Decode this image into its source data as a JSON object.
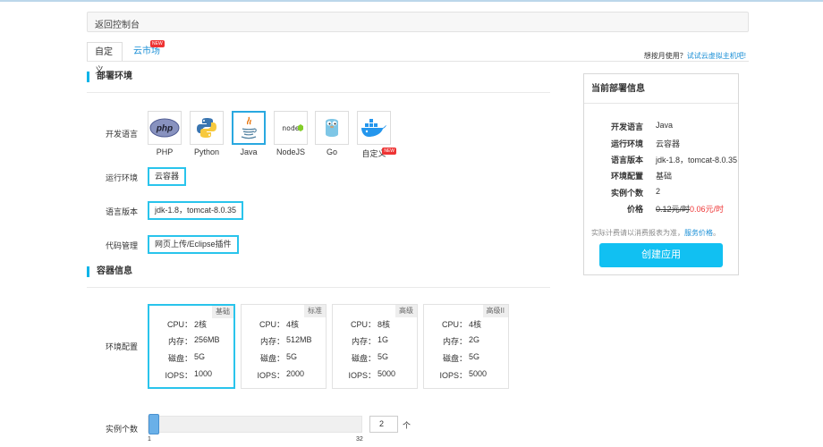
{
  "back_bar": {
    "label": "返回控制台"
  },
  "tabs": [
    {
      "label": "自定义"
    },
    {
      "label": "云市场",
      "badge": "NEW"
    }
  ],
  "monthly": {
    "prefix": "想按月使用？",
    "link": "试试云虚拟主机吧!"
  },
  "sections": {
    "deploy_env": "部署环境",
    "container_info": "容器信息"
  },
  "deploy": {
    "language_label": "开发语言",
    "languages": [
      {
        "name": "PHP",
        "icon": "php-icon"
      },
      {
        "name": "Python",
        "icon": "python-icon"
      },
      {
        "name": "Java",
        "icon": "java-icon",
        "selected": true
      },
      {
        "name": "NodeJS",
        "icon": "nodejs-icon"
      },
      {
        "name": "Go",
        "icon": "go-icon"
      },
      {
        "name": "自定义",
        "icon": "docker-icon",
        "badge": "NEW"
      }
    ],
    "runtime_label": "运行环境",
    "runtime_value": "云容器",
    "version_label": "语言版本",
    "version_value": "jdk-1.8，tomcat-8.0.35",
    "code_label": "代码管理",
    "code_value": "网页上传/Eclipse插件"
  },
  "container": {
    "env_label": "环境配置",
    "cards": [
      {
        "tag": "基础",
        "cpu": "2核",
        "mem": "256MB",
        "disk": "5G",
        "iops": "1000",
        "selected": true
      },
      {
        "tag": "标准",
        "cpu": "4核",
        "mem": "512MB",
        "disk": "5G",
        "iops": "2000"
      },
      {
        "tag": "高级",
        "cpu": "8核",
        "mem": "1G",
        "disk": "5G",
        "iops": "5000"
      },
      {
        "tag": "高级II",
        "cpu": "4核",
        "mem": "2G",
        "disk": "5G",
        "iops": "5000"
      }
    ],
    "spec_keys": {
      "cpu": "CPU：",
      "mem": "内存：",
      "disk": "磁盘：",
      "iops": "IOPS："
    },
    "count_label": "实例个数",
    "slider_min": "1",
    "slider_max": "32",
    "count_value": "2",
    "count_unit": "个"
  },
  "summary": {
    "title": "当前部署信息",
    "rows": [
      {
        "k": "开发语言",
        "v": "Java"
      },
      {
        "k": "运行环境",
        "v": "云容器"
      },
      {
        "k": "语言版本",
        "v": "jdk-1.8，tomcat-8.0.35"
      },
      {
        "k": "环境配置",
        "v": "基础"
      },
      {
        "k": "实例个数",
        "v": "2"
      }
    ],
    "price_label": "价格",
    "price_old": "0.12元/时",
    "price_new": "0.06元/时",
    "note_prefix": "实际计费请以消费报表为准，",
    "note_link": "服务价格",
    "note_suffix": "。",
    "create_label": "创建应用"
  },
  "colors": {
    "accent": "#11c0f2",
    "link": "#1a8fd6",
    "selected_border": "#29c4ec",
    "price_red": "#e33333"
  }
}
